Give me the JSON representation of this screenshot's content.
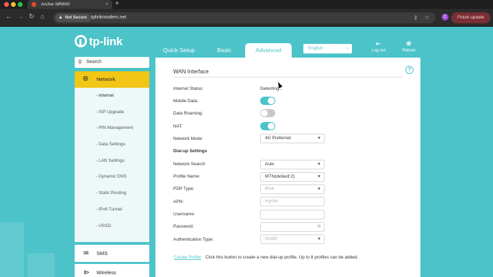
{
  "browser": {
    "tab_title": "Archer MR600",
    "tab_close": "×",
    "new_tab": "+",
    "not_secure": "Not Secure",
    "url": "tplinkmodem.net",
    "profile_letter": "C",
    "finish_update": "Finish update"
  },
  "header": {
    "logo": "tp-link",
    "tabs": [
      "Quick Setup",
      "Basic",
      "Advanced"
    ],
    "language": "English",
    "logout": "Log out",
    "reboot": "Reboot"
  },
  "sidebar": {
    "search_placeholder": "Search",
    "section": "Network",
    "items": [
      "- Internet",
      "- ISP Upgrade",
      "- PIN Management",
      "- Data Settings",
      "- LAN Settings",
      "- Dynamic DNS",
      "- Static Routing",
      "- IPv6 Tunnel",
      "- USSD"
    ],
    "sections": [
      "SMS",
      "Wireless"
    ]
  },
  "content": {
    "title": "WAN Interface",
    "help": "?",
    "internet_status_label": "Internet Status:",
    "internet_status_value": "Detecting...",
    "mobile_data_label": "Mobile Data:",
    "mobile_data_on": true,
    "data_roaming_label": "Data Roaming:",
    "data_roaming_on": false,
    "nat_label": "NAT:",
    "nat_on": true,
    "network_mode_label": "Network Mode:",
    "network_mode_value": "4G Preferred",
    "dialup_heading": "Dial-up Settings",
    "network_search_label": "Network Search:",
    "network_search_value": "Auto",
    "profile_name_label": "Profile Name:",
    "profile_name_value": "MTN(default:2)",
    "pdp_type_label": "PDP Type:",
    "pdp_type_value": "IPv4",
    "apn_label": "APN:",
    "apn_value": "mymtn",
    "username_label": "Username:",
    "username_value": "",
    "password_label": "Password:",
    "password_value": "",
    "auth_type_label": "Authentication Type:",
    "auth_type_value": "CHAP",
    "create_profile": "Create Profile",
    "create_note": "Click this button to create a new dial-up profile. Up to 8 profiles can be added."
  }
}
